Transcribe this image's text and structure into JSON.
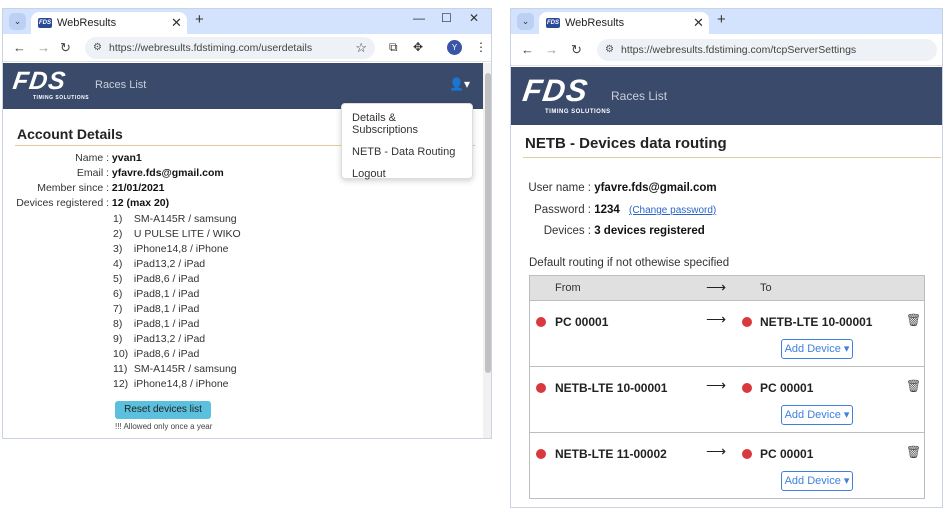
{
  "left": {
    "tab_title": "WebResults",
    "favicon_text": "FDS",
    "url": "https://webresults.fdstiming.com/userdetails",
    "profile_initial": "Y",
    "logo": "FDS",
    "logo_sub": "TIMING SOLUTIONS",
    "nav_races": "Races List",
    "dropdown": [
      "Details & Subscriptions",
      "NETB - Data Routing",
      "Logout"
    ],
    "heading": "Account Details",
    "name_label": "Name :",
    "name_value": "yvan1",
    "email_label": "Email :",
    "email_value": "yfavre.fds@gmail.com",
    "member_label": "Member since :",
    "member_value": "21/01/2021",
    "devices_label": "Devices registered :",
    "devices_value": "12 (max 20)",
    "devices": [
      {
        "n": "1)",
        "d": "SM-A145R / samsung"
      },
      {
        "n": "2)",
        "d": "U PULSE LITE / WIKO"
      },
      {
        "n": "3)",
        "d": "iPhone14,8 / iPhone"
      },
      {
        "n": "4)",
        "d": "iPad13,2 / iPad"
      },
      {
        "n": "5)",
        "d": "iPad8,6 / iPad"
      },
      {
        "n": "6)",
        "d": "iPad8,1 / iPad"
      },
      {
        "n": "7)",
        "d": "iPad8,1 / iPad"
      },
      {
        "n": "8)",
        "d": "iPad8,1 / iPad"
      },
      {
        "n": "9)",
        "d": "iPad13,2 / iPad"
      },
      {
        "n": "10)",
        "d": "iPad8,6 / iPad"
      },
      {
        "n": "11)",
        "d": "SM-A145R / samsung"
      },
      {
        "n": "12)",
        "d": "iPhone14,8 / iPhone"
      }
    ],
    "reset_button": "Reset devices list",
    "reset_note": "!!! Allowed only once a year"
  },
  "right": {
    "tab_title": "WebResults",
    "favicon_text": "FDS",
    "url": "https://webresults.fdstiming.com/tcpServerSettings",
    "logo": "FDS",
    "logo_sub": "TIMING SOLUTIONS",
    "nav_races": "Races List",
    "heading": "NETB - Devices data routing",
    "user_label": "User name :",
    "user_value": "yfavre.fds@gmail.com",
    "pass_label": "Password :",
    "pass_value": "1234",
    "change_password": "(Change password)",
    "devices_label": "Devices :",
    "devices_value": "3 devices registered",
    "default_routing": "Default routing if not othewise specified",
    "col_from": "From",
    "col_to": "To",
    "arrow": "⟶",
    "add_device": "Add Device ▾",
    "routes": [
      {
        "from": "PC 00001",
        "to": "NETB-LTE 10-00001"
      },
      {
        "from": "NETB-LTE 10-00001",
        "to": "PC 00001"
      },
      {
        "from": "NETB-LTE 11-00002",
        "to": "PC 00001"
      }
    ]
  },
  "colors": {
    "tabbar": "#d3e3fd",
    "appbar": "#3a4a6b",
    "status_dot": "#d9383d",
    "reset_button": "#5bc0de",
    "link": "#2a65c9"
  },
  "icons": {
    "tab_list": "chevron-down-icon",
    "close": "close-icon",
    "new_tab": "plus-icon",
    "back": "arrow-left-icon",
    "forward": "arrow-right-icon",
    "reload": "reload-icon",
    "star": "star-icon",
    "user": "user-icon",
    "trash": "trash-icon"
  }
}
